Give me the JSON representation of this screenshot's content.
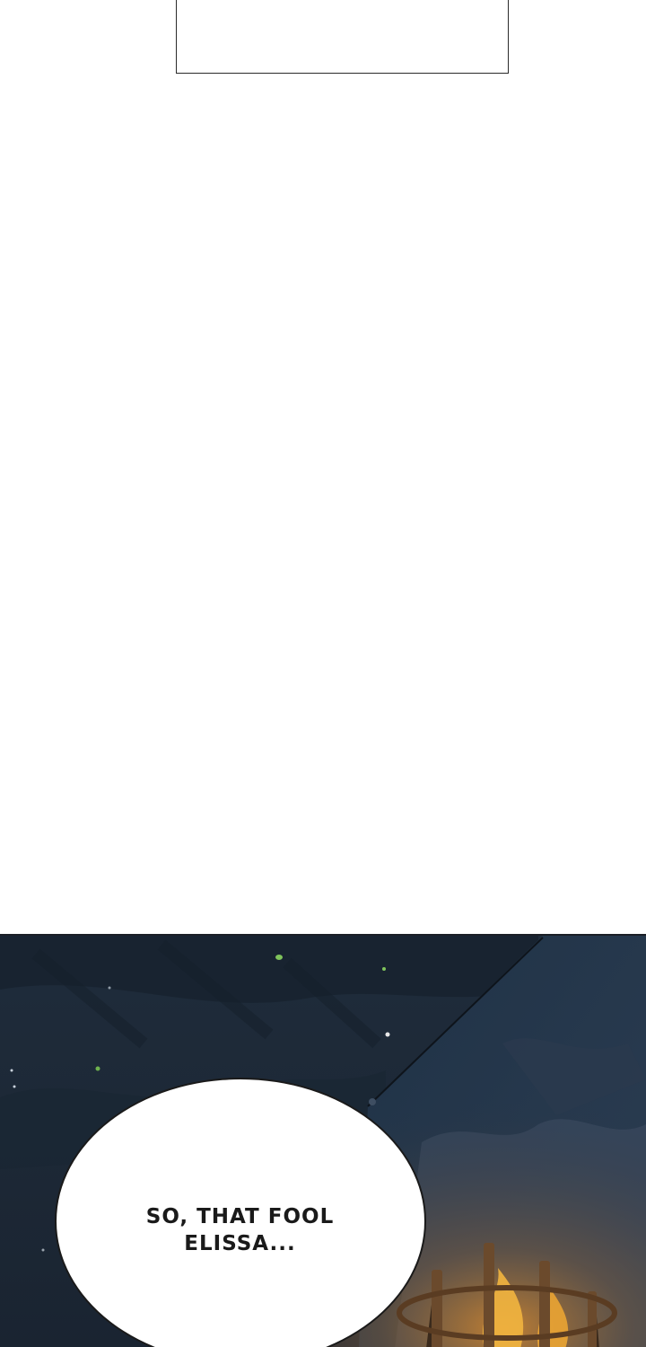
{
  "dialogue": {
    "line1": "SO, THAT FOOL",
    "line2": "ELISSA..."
  },
  "colors": {
    "background": "#ffffff",
    "night_sky": "#1d2a38",
    "bubble_fill": "#ffffff",
    "bubble_outline": "#1a1a1a",
    "firelight": "#e9a23a",
    "spark_green": "#7fc35b"
  },
  "icons": {
    "scene": "night-forest-bonfire-illustration"
  }
}
